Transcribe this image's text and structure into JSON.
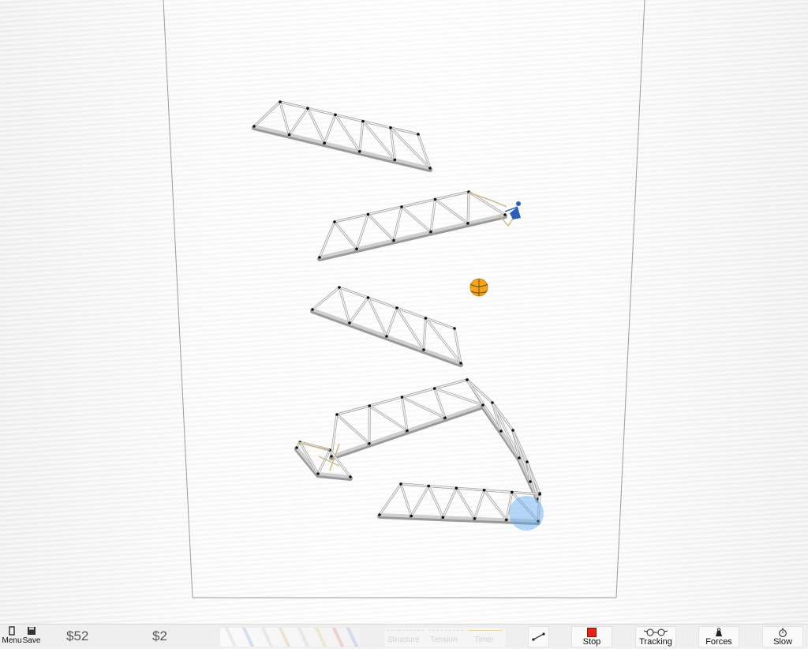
{
  "toolbar": {
    "menu_label": "Menu",
    "save_label": "Save",
    "budget_total": "$52",
    "budget_remaining": "$2",
    "modes": [
      "Structure",
      "Tension",
      "Timer"
    ],
    "stop_label": "Stop",
    "tracking_label": "Tracking",
    "forces_label": "Forces",
    "slow_label": "Slow"
  },
  "colors": {
    "stop": "#e2231a",
    "ball": "#f2a51a",
    "marker": "#5aa6f0",
    "rider": "#2b5fb8",
    "rope": "#cdbb8a"
  },
  "icons": {
    "menu": "door-icon",
    "save": "floppy-disk-icon",
    "line_tool": "line-segment-icon",
    "stop": "stop-square-icon",
    "tracking": "glasses-icon",
    "forces": "weight-icon",
    "slow": "stopwatch-icon"
  }
}
